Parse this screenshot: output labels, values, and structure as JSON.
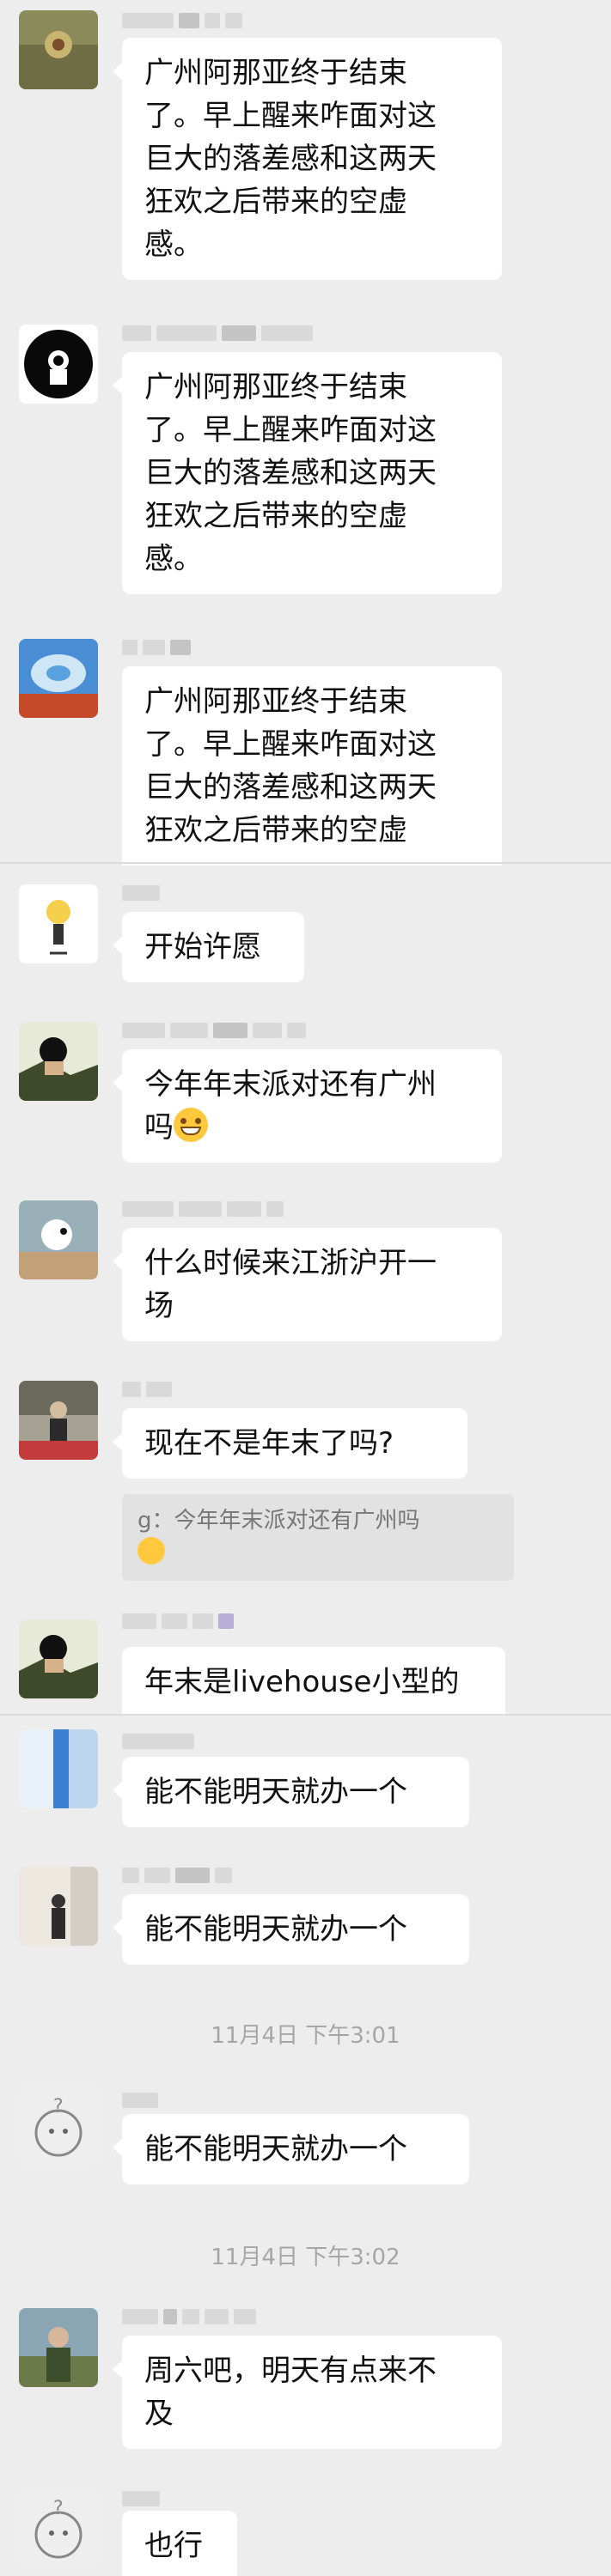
{
  "messages": [
    {
      "avatar": "flower-avatar",
      "text": "广州阿那亚终于结束\n了。早上醒来咋面对这\n巨大的落差感和这两天\n狂欢之后带来的空虚\n感。"
    },
    {
      "avatar": "astronaut-avatar",
      "text": "广州阿那亚终于结束\n了。早上醒来咋面对这\n巨大的落差感和这两天\n狂欢之后带来的空虚\n感。"
    },
    {
      "avatar": "wave-avatar",
      "text": "广州阿那亚终于结束\n了。早上醒来咋面对这\n巨大的落差感和这两天\n狂欢之后带来的空虚"
    },
    {
      "avatar": "cartoon-avatar",
      "text": "开始许愿"
    },
    {
      "avatar": "anime-avatar",
      "text": "今年年末派对还有广州\n吗"
    },
    {
      "avatar": "snoopy-avatar",
      "text": "什么时候来江浙沪开一\n场"
    },
    {
      "avatar": "street-avatar",
      "text": "现在不是年末了吗?"
    },
    {
      "avatar": "anime-avatar",
      "text": "年末是livehouse小型的"
    },
    {
      "avatar": "blue-avatar",
      "text": "能不能明天就办一个"
    },
    {
      "avatar": "room-avatar",
      "text": "能不能明天就办一个"
    },
    {
      "avatar": "sketch-avatar",
      "text": "能不能明天就办一个"
    },
    {
      "avatar": "photo-avatar",
      "text": "周六吧，明天有点来不\n及"
    },
    {
      "avatar": "sketch-avatar",
      "text": "也行"
    }
  ],
  "quote": {
    "text": "g：今年年末派对还有广州吗"
  },
  "timestamps": [
    "11月4日 下午3:01",
    "11月4日 下午3:02"
  ]
}
